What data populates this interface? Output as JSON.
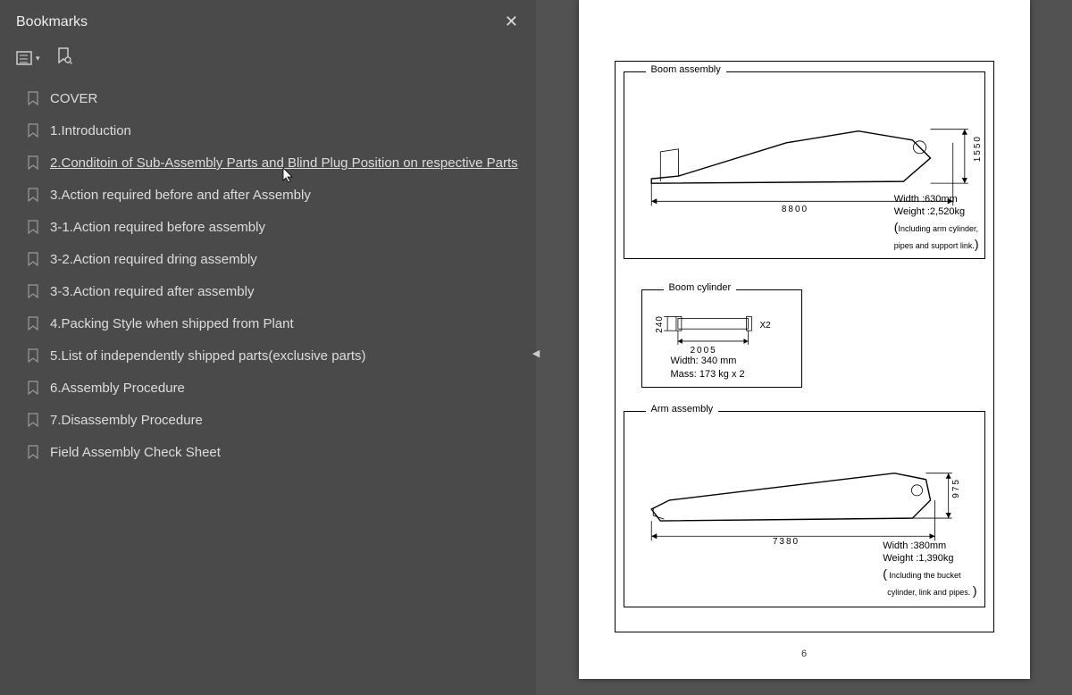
{
  "sidebar": {
    "title": "Bookmarks",
    "items": [
      {
        "label": "COVER"
      },
      {
        "label": "1.Introduction"
      },
      {
        "label": "2.Conditoin of Sub-Assembly Parts and Blind Plug Position on respective Parts",
        "selected": true
      },
      {
        "label": "3.Action required before and after Assembly"
      },
      {
        "label": "3-1.Action required before assembly"
      },
      {
        "label": "3-2.Action required dring assembly"
      },
      {
        "label": "3-3.Action required after assembly"
      },
      {
        "label": "4.Packing Style when shipped from Plant"
      },
      {
        "label": "5.List of independently shipped parts(exclusive parts)"
      },
      {
        "label": "6.Assembly Procedure"
      },
      {
        "label": "7.Disassembly Procedure"
      },
      {
        "label": "Field Assembly Check Sheet"
      }
    ]
  },
  "page": {
    "number": "6",
    "boom_assembly": {
      "title": "Boom assembly",
      "length": "8800",
      "height": "1550",
      "width_line": "Width  :630mm",
      "weight_line": "Weight :2,520kg",
      "note1": "Including arm cylinder,",
      "note2": "pipes and support link."
    },
    "boom_cylinder": {
      "title": "Boom cylinder",
      "length": "2005",
      "height": "240",
      "qty": "X2",
      "width_line": "Width:  340 mm",
      "mass_line": "Mass:  173 kg x 2"
    },
    "arm_assembly": {
      "title": "Arm assembly",
      "length": "7380",
      "height": "975",
      "width_line": "Width  :380mm",
      "weight_line": "Weight :1,390kg",
      "note1": "Including the bucket",
      "note2": "cylinder, link and pipes."
    }
  }
}
